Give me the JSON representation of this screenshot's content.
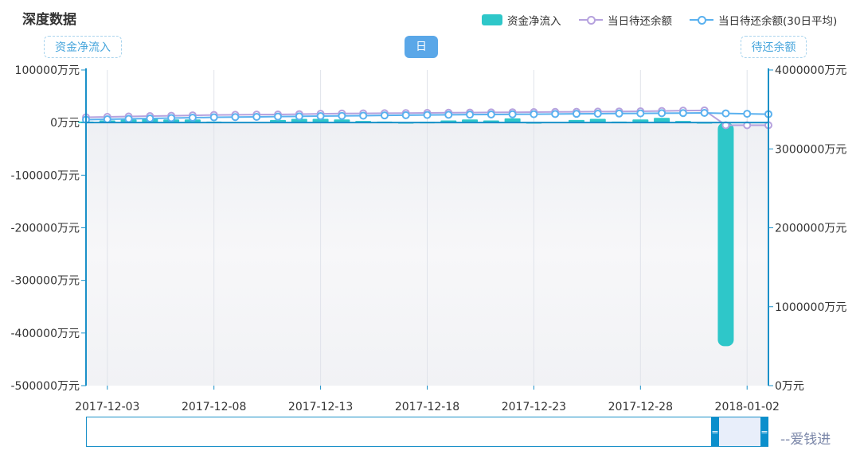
{
  "title": "深度数据",
  "legend": {
    "bar_label": "资金净流入",
    "line1_label": "当日待还余额",
    "line2_label": "当日待还余额(30日平均)"
  },
  "left_axis_label": "资金净流入",
  "right_axis_label": "待还余额",
  "period_button": "日",
  "watermark": "--爱钱进",
  "zoom": {
    "handle_symbol": "="
  },
  "colors": {
    "bar": "#2ec7c9",
    "line1": "#b6a2de",
    "line2": "#5ab1ef",
    "axis": "#1a90c8"
  },
  "chart_data": {
    "type": "bar",
    "x": [
      "2017-12-02",
      "2017-12-03",
      "2017-12-04",
      "2017-12-05",
      "2017-12-06",
      "2017-12-07",
      "2017-12-08",
      "2017-12-09",
      "2017-12-10",
      "2017-12-11",
      "2017-12-12",
      "2017-12-13",
      "2017-12-14",
      "2017-12-15",
      "2017-12-16",
      "2017-12-17",
      "2017-12-18",
      "2017-12-19",
      "2017-12-20",
      "2017-12-21",
      "2017-12-22",
      "2017-12-23",
      "2017-12-24",
      "2017-12-25",
      "2017-12-26",
      "2017-12-27",
      "2017-12-28",
      "2017-12-29",
      "2017-12-30",
      "2017-12-31",
      "2018-01-01",
      "2018-01-02",
      "2018-01-03"
    ],
    "x_ticks": [
      "2017-12-03",
      "2017-12-08",
      "2017-12-13",
      "2017-12-18",
      "2017-12-23",
      "2017-12-28",
      "2018-01-02"
    ],
    "series": [
      {
        "name": "资金净流入",
        "type": "bar",
        "axis": "left",
        "values": [
          2000,
          4000,
          6000,
          8000,
          6000,
          6000,
          2000,
          0,
          0,
          5000,
          7000,
          7000,
          6000,
          3000,
          2000,
          1000,
          1500,
          4000,
          6000,
          4000,
          8000,
          1000,
          0,
          5000,
          7000,
          2000,
          6000,
          9000,
          3000,
          1000,
          -425000,
          null,
          null
        ]
      },
      {
        "name": "当日待还余额",
        "type": "line",
        "axis": "right",
        "values": [
          3400000,
          3405000,
          3410000,
          3415000,
          3420000,
          3425000,
          3430000,
          3432000,
          3434000,
          3436000,
          3440000,
          3444000,
          3448000,
          3450000,
          3452000,
          3454000,
          3456000,
          3458000,
          3460000,
          3462000,
          3464000,
          3466000,
          3468000,
          3470000,
          3472000,
          3474000,
          3476000,
          3480000,
          3485000,
          3488000,
          3300000,
          3300000,
          3300000
        ]
      },
      {
        "name": "当日待还余额(30日平均)",
        "type": "line",
        "axis": "right",
        "values": [
          3370000,
          3375000,
          3380000,
          3385000,
          3390000,
          3395000,
          3400000,
          3403000,
          3406000,
          3409000,
          3412000,
          3415000,
          3418000,
          3421000,
          3424000,
          3427000,
          3430000,
          3432000,
          3434000,
          3436000,
          3438000,
          3440000,
          3442000,
          3444000,
          3446000,
          3448000,
          3450000,
          3452000,
          3454000,
          3456000,
          3450000,
          3445000,
          3440000
        ]
      }
    ],
    "y_left": {
      "min": -500000,
      "max": 100000,
      "ticks": [
        100000,
        0,
        -100000,
        -200000,
        -300000,
        -400000,
        -500000
      ],
      "tick_labels": [
        "100000万元",
        "0万元",
        "-100000万元",
        "-200000万元",
        "-300000万元",
        "-400000万元",
        "-500000万元"
      ]
    },
    "y_right": {
      "min": 0,
      "max": 4000000,
      "ticks": [
        4000000,
        3000000,
        2000000,
        1000000,
        0
      ],
      "tick_labels": [
        "4000000万元",
        "3000000万元",
        "2000000万元",
        "1000000万元",
        "0万元"
      ]
    },
    "grid": true
  }
}
